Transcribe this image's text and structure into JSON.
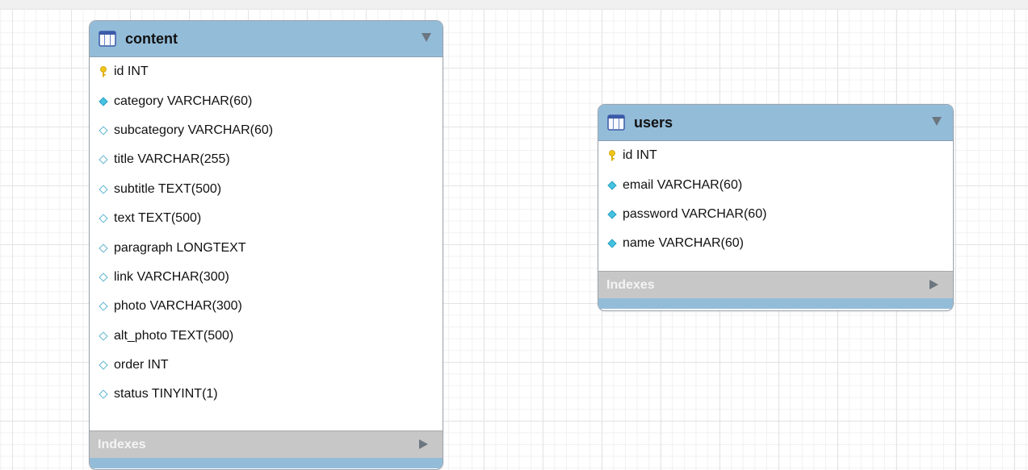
{
  "tables": [
    {
      "name": "content",
      "indexes_label": "Indexes",
      "columns": [
        {
          "text": "id INT",
          "kind": "primary-key"
        },
        {
          "text": "category VARCHAR(60)",
          "kind": "not-null"
        },
        {
          "text": "subcategory VARCHAR(60)",
          "kind": "nullable"
        },
        {
          "text": "title VARCHAR(255)",
          "kind": "nullable"
        },
        {
          "text": "subtitle TEXT(500)",
          "kind": "nullable"
        },
        {
          "text": "text TEXT(500)",
          "kind": "nullable"
        },
        {
          "text": "paragraph LONGTEXT",
          "kind": "nullable"
        },
        {
          "text": "link VARCHAR(300)",
          "kind": "nullable"
        },
        {
          "text": "photo VARCHAR(300)",
          "kind": "nullable"
        },
        {
          "text": "alt_photo TEXT(500)",
          "kind": "nullable"
        },
        {
          "text": "order INT",
          "kind": "nullable"
        },
        {
          "text": "status TINYINT(1)",
          "kind": "nullable"
        }
      ]
    },
    {
      "name": "users",
      "indexes_label": "Indexes",
      "columns": [
        {
          "text": "id INT",
          "kind": "primary-key"
        },
        {
          "text": "email VARCHAR(60)",
          "kind": "not-null"
        },
        {
          "text": "password VARCHAR(60)",
          "kind": "not-null"
        },
        {
          "text": "name VARCHAR(60)",
          "kind": "not-null"
        }
      ]
    }
  ],
  "colors": {
    "header": "#93bcd9",
    "indexes_bar": "#c7c7c7",
    "key_icon": "#f0c419",
    "diamond": "#45c3e3"
  }
}
